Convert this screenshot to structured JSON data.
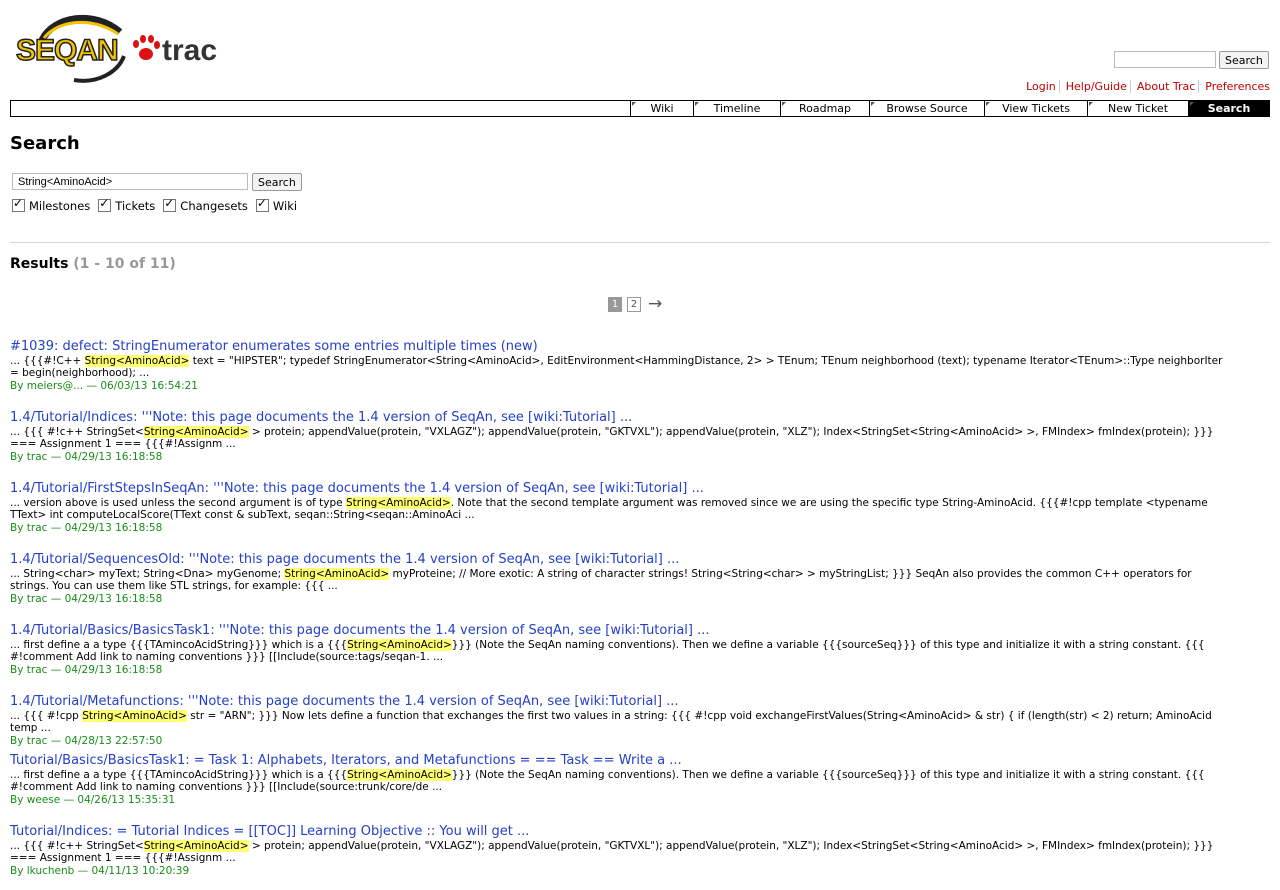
{
  "header": {
    "logo_text": "SEQAN",
    "logo_text2": "trac",
    "search_button": "Search"
  },
  "metanav": [
    "Login",
    "Help/Guide",
    "About Trac",
    "Preferences"
  ],
  "mainnav": [
    {
      "label": "Wiki",
      "width": 62
    },
    {
      "label": "Timeline",
      "width": 86
    },
    {
      "label": "Roadmap",
      "width": 88
    },
    {
      "label": "Browse Source",
      "width": 114
    },
    {
      "label": "View Tickets",
      "width": 102
    },
    {
      "label": "New Ticket",
      "width": 100
    },
    {
      "label": "Search",
      "width": 80,
      "active": true
    }
  ],
  "page": {
    "title": "Search",
    "query": "String<AminoAcid>",
    "search_button": "Search",
    "filters": [
      "Milestones",
      "Tickets",
      "Changesets",
      "Wiki"
    ]
  },
  "results_header": {
    "label": "Results",
    "range": "(1 - 10 of 11)"
  },
  "paging": {
    "current": "1",
    "other": "2",
    "next": "→"
  },
  "highlight": "String<AminoAcid>",
  "results": [
    {
      "title": "#1039: defect: StringEnumerator enumerates some entries multiple times (new)",
      "excerpt_before": "... {{{#!C++ ",
      "excerpt_after": " text = \"HIPSTER\"; typedef StringEnumerator<String<AminoAcid>, EditEnvironment<HammingDistance, 2> > TEnum; TEnum neighborhood (text); typename Iterator<TEnum>::Type neighborIter = begin(neighborhood); ...",
      "author": "meiers@...",
      "date": "06/03/13 16:54:21"
    },
    {
      "title": "1.4/Tutorial/Indices: '''Note: this page documents the 1.4 version of SeqAn, see [wiki:Tutorial] ...",
      "excerpt_before": "... {{{ #!c++ StringSet<",
      "excerpt_after": " > protein; appendValue(protein, \"VXLAGZ\"); appendValue(protein, \"GKTVXL\"); appendValue(protein, \"XLZ\"); Index<StringSet<String<AminoAcid> >, FMIndex> fmIndex(protein); }}} === Assignment 1 === {{{#!Assignm ...",
      "author": "trac",
      "date": "04/29/13 16:18:58"
    },
    {
      "title": "1.4/Tutorial/FirstStepsInSeqAn: '''Note: this page documents the 1.4 version of SeqAn, see [wiki:Tutorial] ...",
      "excerpt_before": "... version above is used unless the second argument is of type ",
      "excerpt_after": ". Note that the second template argument was removed since we are using the specific type String-AminoAcid. {{{#!cpp template <typename TText> int computeLocalScore(TText const & subText, seqan::String<seqan::AminoAci ...",
      "author": "trac",
      "date": "04/29/13 16:18:58"
    },
    {
      "title": "1.4/Tutorial/SequencesOld: '''Note: this page documents the 1.4 version of SeqAn, see [wiki:Tutorial] ...",
      "excerpt_before": "... String<char> myText; String<Dna> myGenome; ",
      "excerpt_after": " myProteine; // More exotic: A string of character strings! String<String<char> > myStringList; }}} SeqAn also provides the common C++ operators for strings. You can use them like STL strings, for example: {{{ ...",
      "author": "trac",
      "date": "04/29/13 16:18:58"
    },
    {
      "title": "1.4/Tutorial/Basics/BasicsTask1: '''Note: this page documents the 1.4 version of SeqAn, see [wiki:Tutorial] ...",
      "excerpt_before": "... first define a a type {{{TAmincoAcidString}}} which is a {{{",
      "excerpt_after": "}}} (Note the SeqAn naming conventions). Then we define a variable {{{sourceSeq}}} of this type and initialize it with a string constant. {{{ #!comment Add link to naming conventions }}} [[Include(source:tags/seqan-1. ...",
      "author": "trac",
      "date": "04/29/13 16:18:58"
    },
    {
      "title": "1.4/Tutorial/Metafunctions: '''Note: this page documents the 1.4 version of SeqAn, see [wiki:Tutorial] ...",
      "excerpt_before": "... {{{ #!cpp ",
      "excerpt_after": " str = \"ARN\"; }}} Now lets define a function that exchanges the first two values in a string: {{{ #!cpp void exchangeFirstValues(String<AminoAcid> & str) { if (length(str) < 2) return; AminoAcid temp ...",
      "author": "trac",
      "date": "04/28/13 22:57:50"
    },
    {
      "title": "Tutorial/Basics/BasicsTask1: = Task 1: Alphabets, Iterators, and Metafunctions = == Task == Write a ...",
      "excerpt_before": "... first define a a type {{{TAmincoAcidString}}} which is a {{{",
      "excerpt_after": "}}} (Note the SeqAn naming conventions). Then we define a variable {{{sourceSeq}}} of this type and initialize it with a string constant. {{{ #!comment Add link to naming conventions }}} [[Include(source:trunk/core/de ...",
      "author": "weese",
      "date": "04/26/13 15:35:31"
    },
    {
      "title": "Tutorial/Indices: = Tutorial Indices = [[TOC]] Learning Objective :: You will get ...",
      "excerpt_before": "... {{{ #!c++ StringSet<",
      "excerpt_after": " > protein; appendValue(protein, \"VXLAGZ\"); appendValue(protein, \"GKTVXL\"); appendValue(protein, \"XLZ\"); Index<StringSet<String<AminoAcid> >, FMIndex> fmIndex(protein); }}} === Assignment 1 === {{{#!Assignm ...",
      "author": "lkuchenb",
      "date": "04/11/13 10:20:39"
    }
  ],
  "by_prefix": "By",
  "date_sep": "—",
  "colors": {
    "link": "#2440c8",
    "meta": "#1a8c1a",
    "metanav": "#bb0000",
    "highlight": "#ffff70",
    "logo_yellow": "#f2c200"
  }
}
